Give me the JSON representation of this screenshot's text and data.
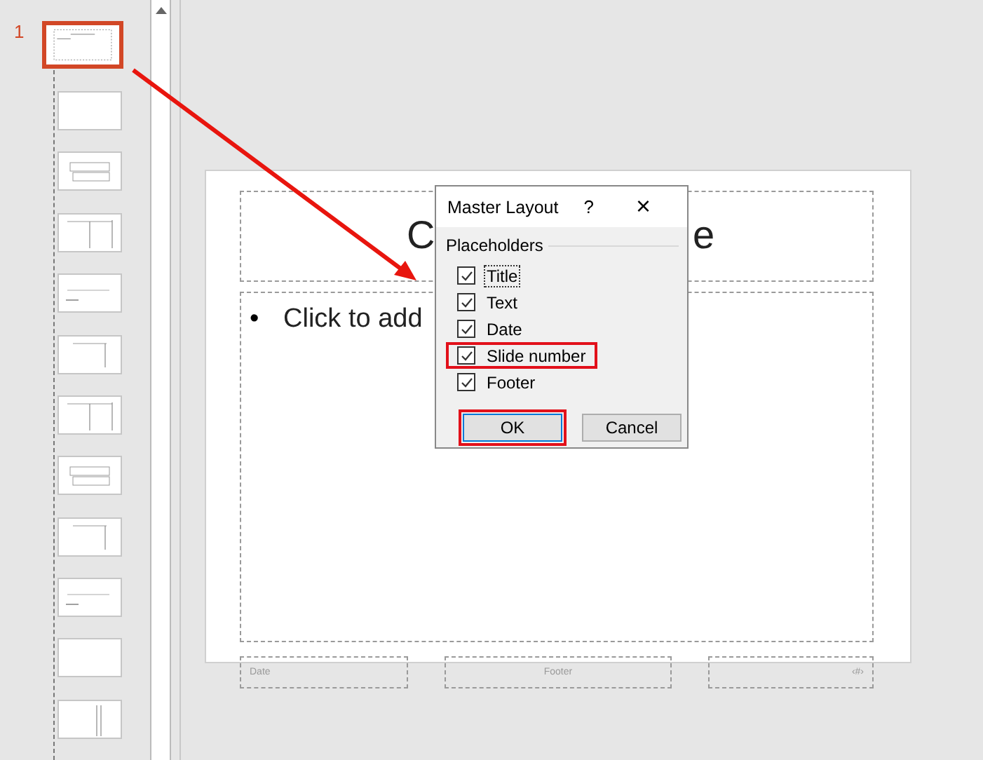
{
  "thumbnails": [
    {
      "number": "1",
      "selected": true
    },
    {
      "selected": false
    },
    {
      "selected": false
    },
    {
      "selected": false
    },
    {
      "selected": false
    },
    {
      "selected": false
    },
    {
      "selected": false
    },
    {
      "selected": false
    },
    {
      "selected": false
    },
    {
      "selected": false
    },
    {
      "selected": false
    },
    {
      "selected": false
    }
  ],
  "slide": {
    "title_left": "C",
    "title_right": "e",
    "body_bullet": "•",
    "body_text": "Click to add",
    "footer_date": "Date",
    "footer_center": "Footer",
    "footer_number": "‹#›"
  },
  "dialog": {
    "title": "Master Layout",
    "help": "?",
    "close": "×",
    "group": "Placeholders",
    "options": [
      {
        "label": "Title",
        "checked": true,
        "focused": true,
        "annotated": false
      },
      {
        "label": "Text",
        "checked": true,
        "focused": false,
        "annotated": false
      },
      {
        "label": "Date",
        "checked": true,
        "focused": false,
        "annotated": false
      },
      {
        "label": "Slide number",
        "checked": true,
        "focused": false,
        "annotated": true
      },
      {
        "label": "Footer",
        "checked": true,
        "focused": false,
        "annotated": false
      }
    ],
    "buttons": [
      {
        "label": "OK",
        "default": true,
        "annotated": true
      },
      {
        "label": "Cancel",
        "default": false,
        "annotated": false
      }
    ]
  }
}
